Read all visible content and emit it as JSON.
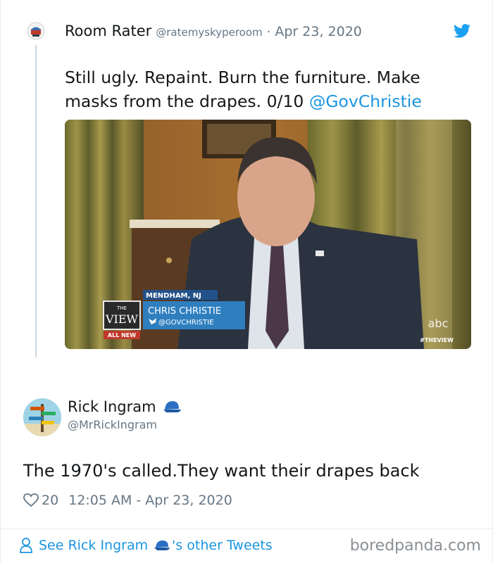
{
  "quoted_tweet": {
    "author_name": "Room Rater",
    "author_handle": "@ratemyskyperoom",
    "separator": "·",
    "date": "Apr 23, 2020",
    "text": "Still ugly. Repaint. Burn the furniture. Make masks from the drapes. 0/10 ",
    "mention": "@GovChristie",
    "avatar_icon": "room-rater-logo-icon",
    "platform_icon": "twitter-bird-icon"
  },
  "video_frame": {
    "location": "MENDHAM, NJ",
    "person_name": "CHRIS CHRISTIE",
    "person_handle": "@GOVCHRISTIE",
    "show_logo_small": "THE",
    "show_logo_big": "VIEW",
    "show_tag": "ALL NEW",
    "network": "abc",
    "hashtag": "#THEVIEW"
  },
  "reply": {
    "author_name": "Rick Ingram",
    "author_handle": "@MrRickIngram",
    "badge_icon": "blue-cap-icon",
    "text": "The 1970's called.They want their drapes back",
    "likes": "20",
    "timestamp": "12:05 AM - Apr 23, 2020"
  },
  "footer": {
    "see_prefix": "See Rick Ingram",
    "see_suffix": "'s other Tweets",
    "watermark": "boredpanda.com"
  },
  "colors": {
    "link": "#1b95e0",
    "muted": "#657786",
    "text": "#14171a",
    "banner_blue": "#2f7fbf"
  }
}
